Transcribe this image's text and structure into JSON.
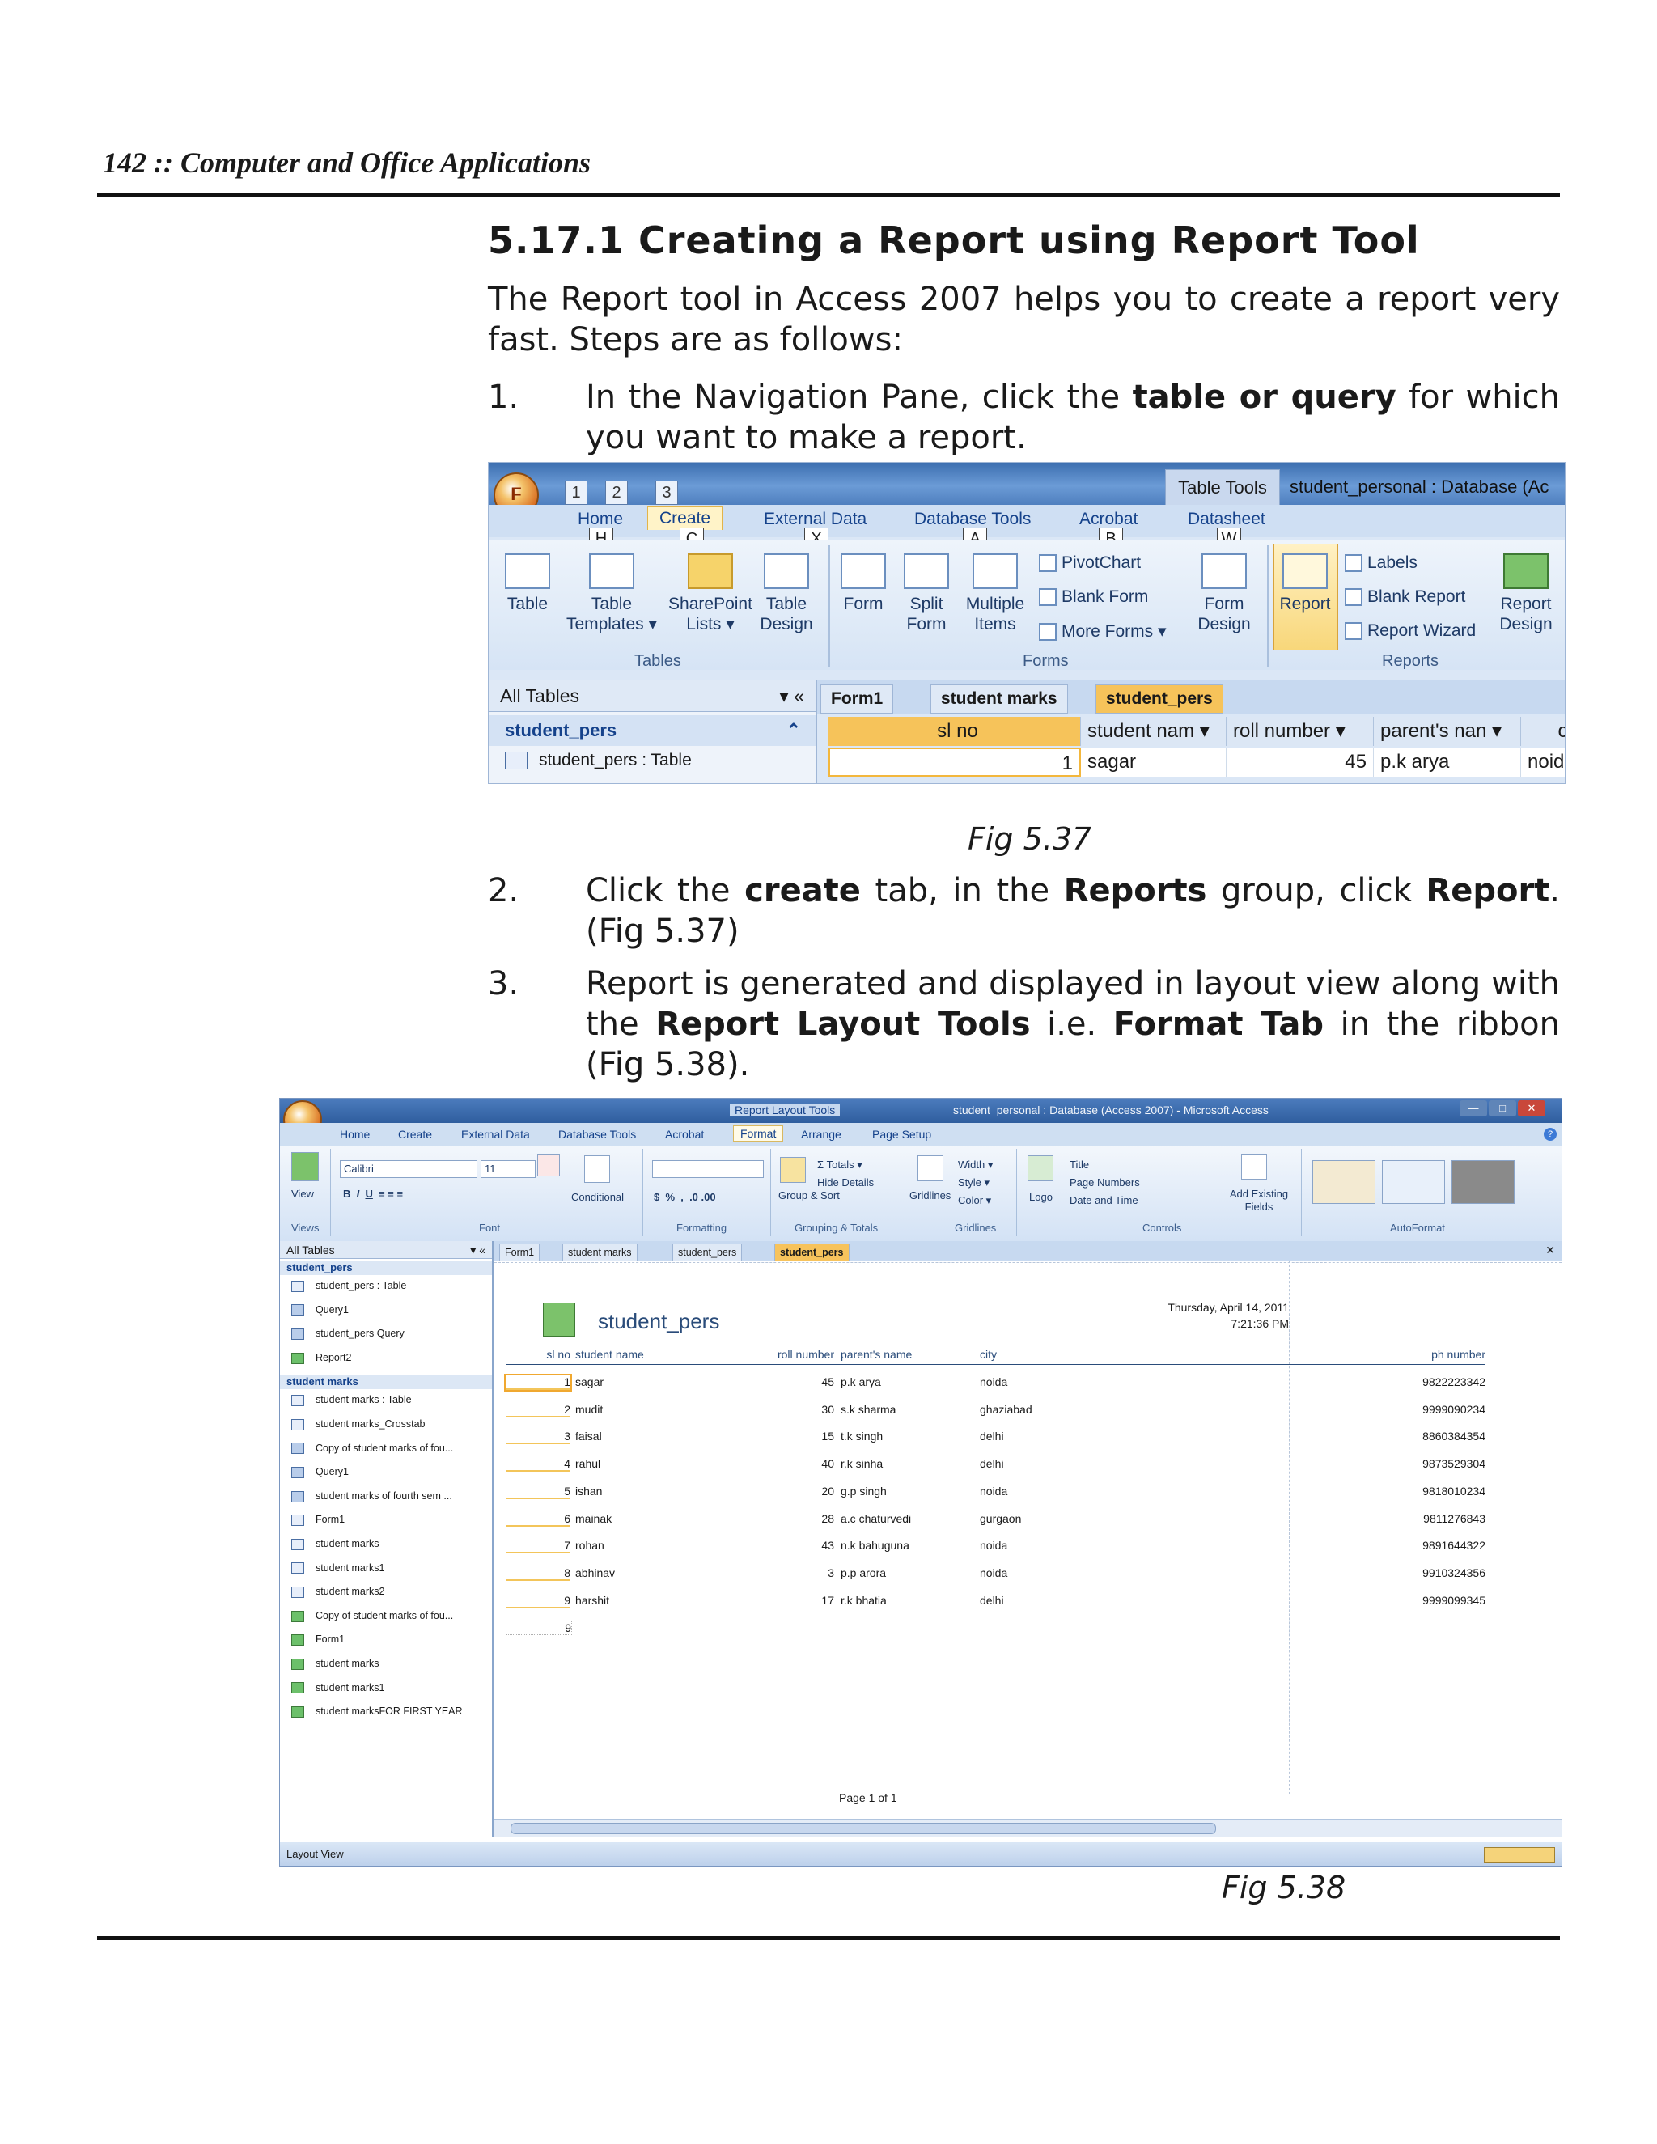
{
  "page_header": "142 :: Computer and Office Applications",
  "section_title": "5.17.1 Creating a Report using Report Tool",
  "intro": "The Report tool in Access 2007 helps you to create a report very fast. Steps are as follows:",
  "steps": [
    {
      "num": "1.",
      "before": "In the Navigation Pane, click the ",
      "bold1": "table or query",
      "after": " for which you want to make a report."
    },
    {
      "num": "2.",
      "t1": "Click the ",
      "b1": "create",
      "t2": " tab, in the ",
      "b2": "Reports",
      "t3": " group, click ",
      "b3": "Report",
      "t4": ". (Fig 5.37)"
    },
    {
      "num": "3.",
      "t1": "Report is generated and displayed in layout view along with the ",
      "b1": "Report Layout Tools",
      "t2": " i.e. ",
      "b2": "Format Tab",
      "t3": " in the ribbon (Fig 5.38)."
    }
  ],
  "fig1": {
    "caption": "Fig 5.37",
    "office_key": "F",
    "qat_keys": [
      "1",
      "2",
      "3"
    ],
    "context_tab": "Table Tools",
    "window_title": "student_personal : Database (Ac",
    "tabs": [
      "Home",
      "Create",
      "External Data",
      "Database Tools",
      "Acrobat",
      "Datasheet"
    ],
    "keytips": [
      "H",
      "C",
      "X",
      "A",
      "B",
      "W"
    ],
    "groups": {
      "tables": "Tables",
      "forms": "Forms",
      "reports": "Reports"
    },
    "buttons": {
      "table": "Table",
      "table_templates": "Table Templates ▾",
      "sharepoint": "SharePoint Lists ▾",
      "table_design": "Table Design",
      "form": "Form",
      "split_form": "Split Form",
      "multiple_items": "Multiple Items",
      "pivotchart": "PivotChart",
      "blank_form": "Blank Form",
      "more_forms": "More Forms ▾",
      "form_design": "Form Design",
      "report": "Report",
      "labels": "Labels",
      "blank_report": "Blank Report",
      "report_wizard": "Report Wizard",
      "report_design": "Report Design"
    },
    "nav_header": "All Tables",
    "nav_group": "student_pers",
    "nav_item": "student_pers : Table",
    "doc_tabs": [
      "Form1",
      "student marks",
      "student_pers"
    ],
    "grid_headers": [
      "sl no",
      "student nam ▾",
      "roll number ▾",
      "parent's nan ▾",
      "city"
    ],
    "grid_row": [
      "1",
      "sagar",
      "45",
      "p.k arya",
      "noida"
    ]
  },
  "fig2": {
    "caption": "Fig 5.38",
    "context_tab": "Report Layout Tools",
    "window_title": "student_personal : Database (Access 2007) - Microsoft Access",
    "tabs": [
      "Home",
      "Create",
      "External Data",
      "Database Tools",
      "Acrobat",
      "Format",
      "Arrange",
      "Page Setup"
    ],
    "groups": [
      "Views",
      "Font",
      "Formatting",
      "Grouping & Totals",
      "Gridlines",
      "Controls",
      "AutoFormat"
    ],
    "ribbon": {
      "view": "View",
      "font_name": "Calibri",
      "font_size": "11",
      "conditional": "Conditional",
      "totals": "Σ Totals ▾",
      "hide_details": "Hide Details",
      "group_sort": "Group & Sort",
      "gridlines": "Gridlines",
      "width": "Width ▾",
      "style": "Style ▾",
      "color": "Color ▾",
      "logo": "Logo",
      "title": "Title",
      "page_numbers": "Page Numbers",
      "date_time": "Date and Time",
      "add_fields": "Add Existing Fields"
    },
    "nav_header": "All Tables",
    "nav_groups": [
      {
        "name": "student_pers",
        "items": [
          {
            "label": "student_pers : Table",
            "kind": "table"
          },
          {
            "label": "Query1",
            "kind": "query"
          },
          {
            "label": "student_pers Query",
            "kind": "query"
          },
          {
            "label": "Report2",
            "kind": "form"
          }
        ]
      },
      {
        "name": "student marks",
        "items": [
          {
            "label": "student marks : Table",
            "kind": "table"
          },
          {
            "label": "student marks_Crosstab",
            "kind": "table"
          },
          {
            "label": "Copy of student marks of fou...",
            "kind": "query"
          },
          {
            "label": "Query1",
            "kind": "query"
          },
          {
            "label": "student marks of fourth sem ...",
            "kind": "query"
          },
          {
            "label": "Form1",
            "kind": "table"
          },
          {
            "label": "student marks",
            "kind": "table"
          },
          {
            "label": "student marks1",
            "kind": "table"
          },
          {
            "label": "student marks2",
            "kind": "table"
          },
          {
            "label": "Copy of student marks of fou...",
            "kind": "form"
          },
          {
            "label": "Form1",
            "kind": "form"
          },
          {
            "label": "student marks",
            "kind": "form"
          },
          {
            "label": "student marks1",
            "kind": "form"
          },
          {
            "label": "student marksFOR FIRST YEAR",
            "kind": "form"
          }
        ]
      }
    ],
    "doc_tabs": [
      "Form1",
      "student marks",
      "student_pers",
      "student_pers"
    ],
    "report_title": "student_pers",
    "report_date": "Thursday, April 14, 2011",
    "report_time": "7:21:36 PM",
    "columns": [
      "sl no",
      "student name",
      "roll number",
      "parent's name",
      "city",
      "ph number"
    ],
    "rows": [
      [
        "1",
        "sagar",
        "45",
        "p.k arya",
        "noida",
        "9822223342"
      ],
      [
        "2",
        "mudit",
        "30",
        "s.k sharma",
        "ghaziabad",
        "9999090234"
      ],
      [
        "3",
        "faisal",
        "15",
        "t.k singh",
        "delhi",
        "8860384354"
      ],
      [
        "4",
        "rahul",
        "40",
        "r.k sinha",
        "delhi",
        "9873529304"
      ],
      [
        "5",
        "ishan",
        "20",
        "g.p singh",
        "noida",
        "9818010234"
      ],
      [
        "6",
        "mainak",
        "28",
        "a.c chaturvedi",
        "gurgaon",
        "9811276843"
      ],
      [
        "7",
        "rohan",
        "43",
        "n.k bahuguna",
        "noida",
        "9891644322"
      ],
      [
        "8",
        "abhinav",
        "3",
        "p.p arora",
        "noida",
        "9910324356"
      ],
      [
        "9",
        "harshit",
        "17",
        "r.k bhatia",
        "delhi",
        "9999099345"
      ]
    ],
    "record_count": "9",
    "page_footer": "Page 1 of 1",
    "status": "Layout View"
  }
}
